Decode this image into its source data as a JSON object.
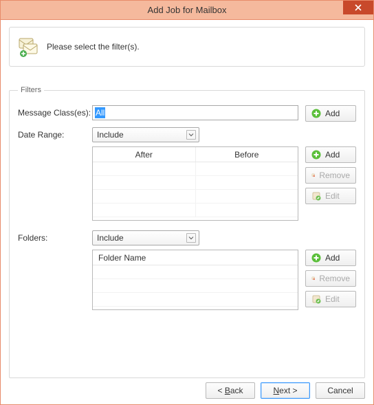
{
  "window": {
    "title": "Add Job for Mailbox"
  },
  "banner": {
    "message": "Please select the filter(s)."
  },
  "filters": {
    "legend": "Filters",
    "messageClass": {
      "label": "Message Class(es):",
      "value": "All"
    },
    "dateRange": {
      "label": "Date Range:",
      "mode": "Include",
      "columns": {
        "after": "After",
        "before": "Before"
      }
    },
    "folders": {
      "label": "Folders:",
      "mode": "Include",
      "column": "Folder Name"
    }
  },
  "buttons": {
    "add": "Add",
    "remove": "Remove",
    "edit": "Edit",
    "back": "< Back",
    "next": "Next >",
    "cancel": "Cancel"
  }
}
